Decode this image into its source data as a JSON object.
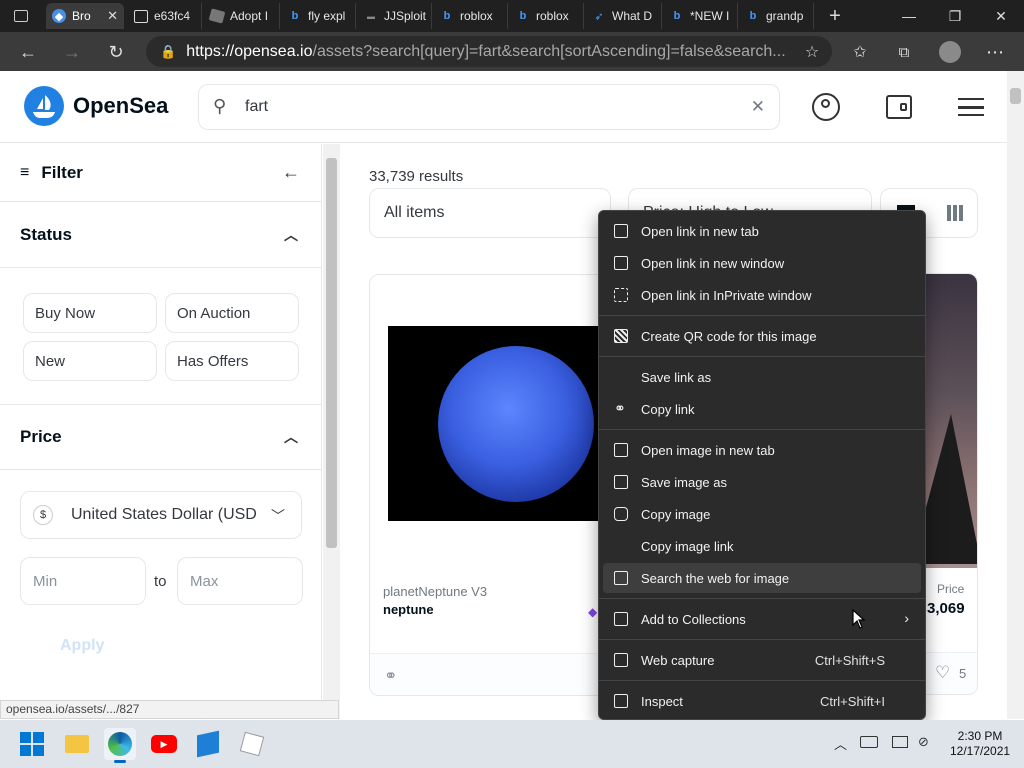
{
  "tabs": [
    {
      "label": "Bro",
      "active": true
    },
    {
      "label": "e63fc4"
    },
    {
      "label": "Adopt I"
    },
    {
      "label": "fly expl"
    },
    {
      "label": "JJSploit"
    },
    {
      "label": "roblox"
    },
    {
      "label": "roblox"
    },
    {
      "label": "What D"
    },
    {
      "label": "*NEW I"
    },
    {
      "label": "grandp"
    }
  ],
  "address": {
    "host": "https://opensea.io",
    "rest": "/assets?search[query]=fart&search[sortAscending]=false&search..."
  },
  "header": {
    "brand": "OpenSea",
    "search_value": "fart"
  },
  "sidebar": {
    "filter_label": "Filter",
    "status_label": "Status",
    "status_buttons": [
      "Buy Now",
      "On Auction",
      "New",
      "Has Offers"
    ],
    "price_label": "Price",
    "currency_symbol": "$",
    "currency": "United States Dollar (USD",
    "min_placeholder": "Min",
    "to_label": "to",
    "max_placeholder": "Max",
    "apply_label": "Apply"
  },
  "main": {
    "results": "33,739 results",
    "items_dropdown": "All items",
    "sort_dropdown": "Price: High to Low",
    "card1": {
      "collection": "planetNeptune V3",
      "name": "neptune"
    },
    "card2": {
      "price_label": "Price",
      "price": "3,069",
      "likes": "5"
    }
  },
  "statusbar": "opensea.io/assets/.../827",
  "context_menu": {
    "items": [
      {
        "label": "Open link in new tab",
        "shortcut": ""
      },
      {
        "label": "Open link in new window",
        "shortcut": ""
      },
      {
        "label": "Open link in InPrivate window",
        "shortcut": ""
      },
      {
        "label": "Create QR code for this image",
        "shortcut": ""
      },
      {
        "label": "Save link as",
        "shortcut": ""
      },
      {
        "label": "Copy link",
        "shortcut": ""
      },
      {
        "label": "Open image in new tab",
        "shortcut": ""
      },
      {
        "label": "Save image as",
        "shortcut": ""
      },
      {
        "label": "Copy image",
        "shortcut": ""
      },
      {
        "label": "Copy image link",
        "shortcut": ""
      },
      {
        "label": "Search the web for image",
        "shortcut": ""
      },
      {
        "label": "Add to Collections",
        "shortcut": ""
      },
      {
        "label": "Web capture",
        "shortcut": "Ctrl+Shift+S"
      },
      {
        "label": "Inspect",
        "shortcut": "Ctrl+Shift+I"
      }
    ]
  },
  "taskbar": {
    "time": "2:30 PM",
    "date": "12/17/2021"
  },
  "colors": {
    "opensea_blue": "#2081e2",
    "menu_bg": "#2b2b2b",
    "chrome_dark": "#202020"
  }
}
